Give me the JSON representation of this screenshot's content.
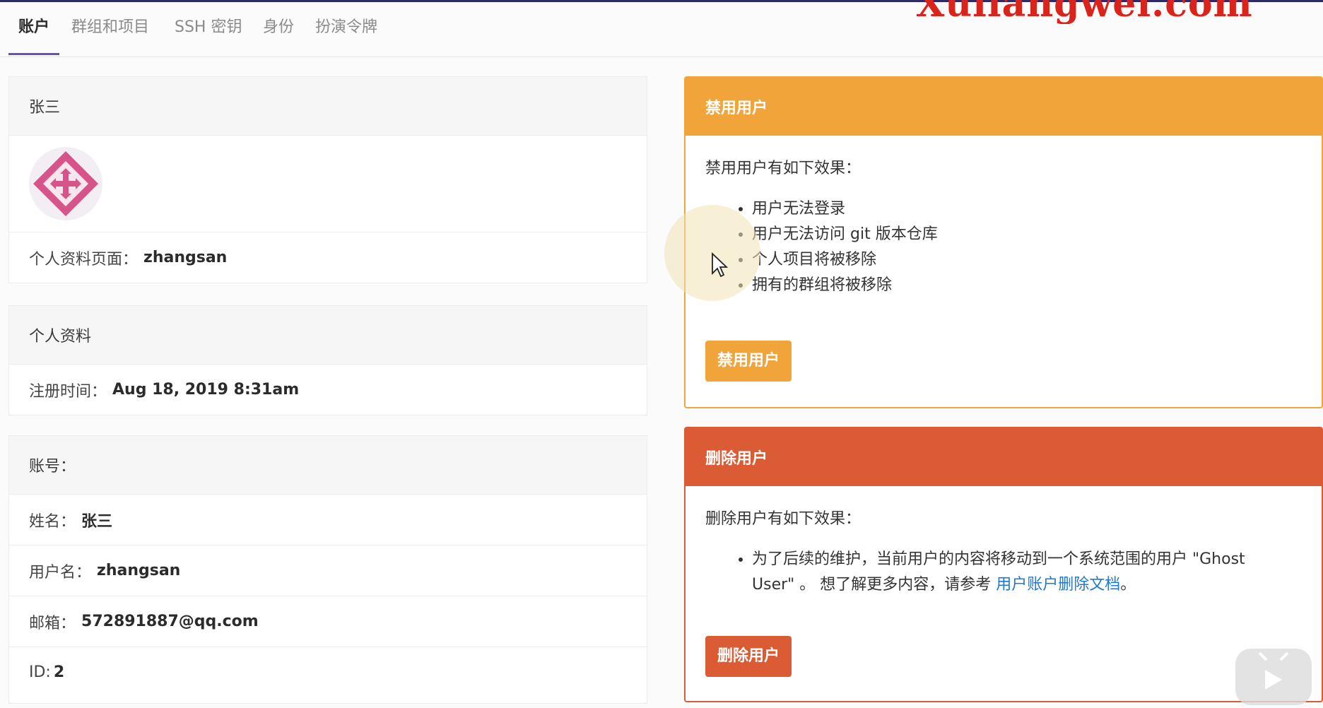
{
  "watermark": "Xuliangwei.com",
  "tabs": [
    {
      "label": "账户",
      "active": true
    },
    {
      "label": "群组和项目"
    },
    {
      "label": "SSH 密钥"
    },
    {
      "label": "身份"
    },
    {
      "label": "扮演令牌"
    }
  ],
  "profile": {
    "name": "张三",
    "page_label": "个人资料页面：",
    "page_value": "zhangsan"
  },
  "personal_info": {
    "title": "个人资料",
    "registered_label": "注册时间：",
    "registered_value": "Aug 18, 2019 8:31am"
  },
  "account": {
    "title": "账号：",
    "name_label": "姓名：",
    "name_value": "张三",
    "username_label": "用户名：",
    "username_value": "zhangsan",
    "email_label": "邮箱：",
    "email_value": "572891887@qq.com",
    "id_label": "ID:",
    "id_value": "2"
  },
  "block_user": {
    "title": "禁用用户",
    "intro": "禁用用户有如下效果：",
    "effects": [
      "用户无法登录",
      "用户无法访问 git 版本仓库",
      "个人项目将被移除",
      "拥有的群组将被移除"
    ],
    "button": "禁用用户",
    "color": "#f0a43a"
  },
  "delete_user": {
    "title": "删除用户",
    "intro": "删除用户有如下效果：",
    "effect_text": "为了后续的维护，当前用户的内容将移动到一个系统范围的用户 \"Ghost User\" 。 想了解更多内容，请参考",
    "effect_link": "用户账户删除文档",
    "effect_end": "。",
    "button": "删除用户",
    "color": "#db5b35"
  }
}
